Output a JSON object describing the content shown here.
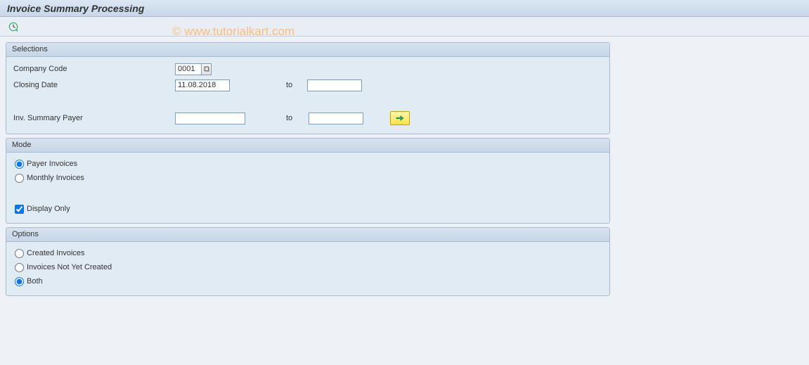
{
  "title": "Invoice Summary Processing",
  "watermark": "© www.tutorialkart.com",
  "panels": {
    "selections": {
      "title": "Selections",
      "company_code": {
        "label": "Company Code",
        "value": "0001"
      },
      "closing_date": {
        "label": "Closing Date",
        "from": "11.08.2018",
        "to_label": "to",
        "to": ""
      },
      "inv_summary_payer": {
        "label": "Inv. Summary Payer",
        "from": "",
        "to_label": "to",
        "to": ""
      }
    },
    "mode": {
      "title": "Mode",
      "radios": {
        "payer_invoices": "Payer Invoices",
        "monthly_invoices": "Monthly Invoices"
      },
      "selected": "payer_invoices",
      "display_only": {
        "label": "Display Only",
        "checked": true
      }
    },
    "options": {
      "title": "Options",
      "radios": {
        "created": "Created Invoices",
        "not_yet": "Invoices Not Yet Created",
        "both": "Both"
      },
      "selected": "both"
    }
  }
}
